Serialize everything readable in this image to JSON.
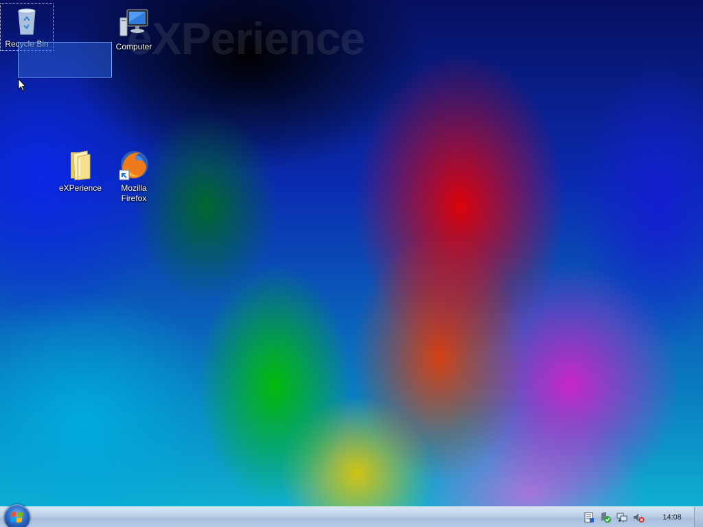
{
  "desktop": {
    "watermark": "eXPerience",
    "icons": [
      {
        "label": "Recycle Bin",
        "icon": "recycle-bin-icon"
      },
      {
        "label": "Computer",
        "icon": "computer-icon"
      },
      {
        "label": "eXPerience",
        "icon": "folder-icon"
      },
      {
        "label": "Mozilla Firefox",
        "icon": "firefox-icon"
      }
    ]
  },
  "taskbar": {
    "start_button": {
      "icon": "windows-logo-icon"
    },
    "tray_icons": [
      "action-center-icon",
      "security-icon",
      "network-icon",
      "volume-muted-icon"
    ],
    "clock": "14:08"
  },
  "colors": {
    "taskbar": "#b9cde4",
    "selection": "#285ac8"
  }
}
